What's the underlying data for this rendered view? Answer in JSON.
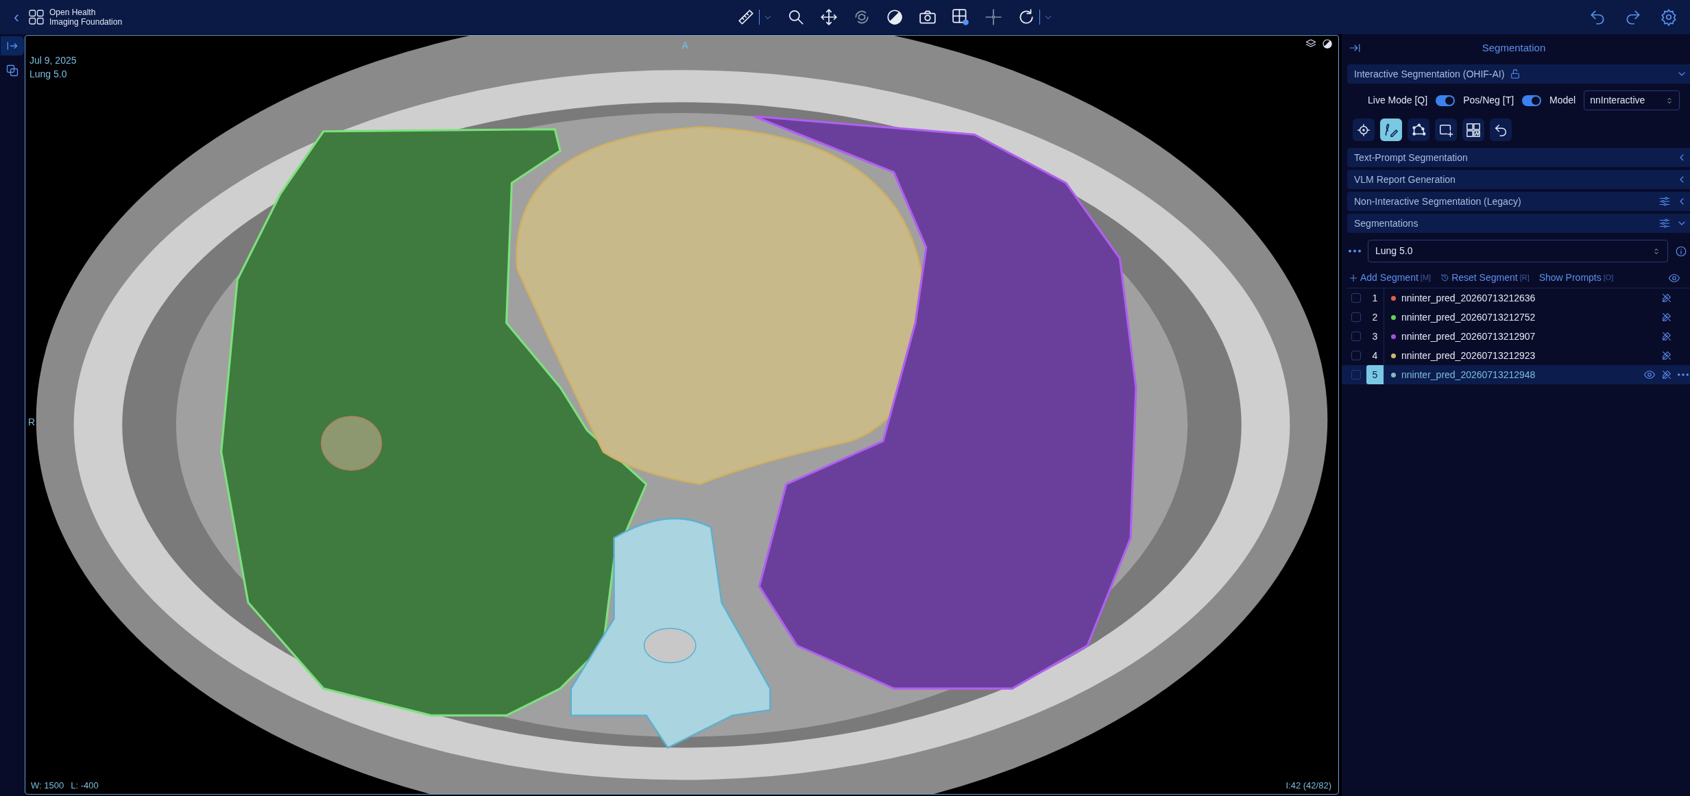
{
  "header": {
    "back": "‹",
    "brand": [
      "Open Health",
      "Imaging Foundation"
    ]
  },
  "toolbar": [
    {
      "kind": "ruler",
      "menu": true,
      "disabled": false
    },
    {
      "kind": "zoom",
      "menu": false,
      "disabled": false
    },
    {
      "kind": "pan",
      "menu": false,
      "disabled": false
    },
    {
      "kind": "rotate3d",
      "menu": false,
      "disabled": true
    },
    {
      "kind": "contrast",
      "menu": false,
      "disabled": false
    },
    {
      "kind": "camera",
      "menu": false,
      "disabled": false
    },
    {
      "kind": "layout",
      "menu": false,
      "disabled": false
    },
    {
      "kind": "crosshair",
      "menu": false,
      "disabled": true
    },
    {
      "kind": "reset",
      "menu": true,
      "disabled": false
    }
  ],
  "toolbar_right": [
    {
      "kind": "undo"
    },
    {
      "kind": "redo"
    },
    {
      "kind": "settings"
    }
  ],
  "left_sidebar": [
    {
      "kind": "expand",
      "selected": true
    },
    {
      "kind": "copy",
      "selected": false
    }
  ],
  "viewport": {
    "top_marker": "A",
    "left_marker": "R",
    "date": "Jul 9, 2025",
    "series": "Lung 5.0",
    "window": "W: 1500",
    "level": "L: -400",
    "slice": "I:42 (42/82)"
  },
  "panel": {
    "title": "Segmentation",
    "sections": [
      {
        "kind": "interactive",
        "title": "Interactive Segmentation (OHIF-AI)",
        "expanded": true,
        "locked": false,
        "settings": false
      },
      {
        "kind": "plain",
        "title": "Text-Prompt Segmentation",
        "expanded": false,
        "settings": false
      },
      {
        "kind": "plain",
        "title": "VLM Report Generation",
        "expanded": false,
        "settings": false
      },
      {
        "kind": "plain",
        "title": "Non-Interactive Segmentation (Legacy)",
        "expanded": false,
        "settings": true
      },
      {
        "kind": "segmentations",
        "title": "Segmentations",
        "expanded": true,
        "settings": true
      }
    ],
    "toggles": [
      {
        "label": "Live Mode [Q]",
        "on": true
      },
      {
        "label": "Pos/Neg [T]",
        "on": true
      }
    ],
    "model": {
      "label": "Model",
      "value": "nnInteractive"
    },
    "tools": [
      {
        "kind": "point",
        "selected": false
      },
      {
        "kind": "scribble",
        "selected": true
      },
      {
        "kind": "lasso",
        "selected": false
      },
      {
        "kind": "box",
        "selected": false
      },
      {
        "kind": "grid",
        "selected": false
      },
      {
        "kind": "undo",
        "selected": false
      }
    ],
    "segmentation_select": "Lung 5.0",
    "actions": [
      {
        "kind": "add",
        "label": "Add Segment",
        "shortcut": "[M]"
      },
      {
        "kind": "reset",
        "label": "Reset Segment",
        "shortcut": "[R]"
      },
      {
        "kind": "show",
        "label": "Show Prompts",
        "shortcut": "[O]"
      }
    ],
    "segments": [
      {
        "number": "1",
        "label": "nninter_pred_20260713212636",
        "color": "#e0604f",
        "selected": false
      },
      {
        "number": "2",
        "label": "nninter_pred_20260713212752",
        "color": "#5fd35f",
        "selected": false
      },
      {
        "number": "3",
        "label": "nninter_pred_20260713212907",
        "color": "#a64fe0",
        "selected": false
      },
      {
        "number": "4",
        "label": "nninter_pred_20260713212923",
        "color": "#c8b870",
        "selected": false
      },
      {
        "number": "5",
        "label": "nninter_pred_20260713212948",
        "color": "#8ab7c2",
        "selected": true
      }
    ]
  }
}
